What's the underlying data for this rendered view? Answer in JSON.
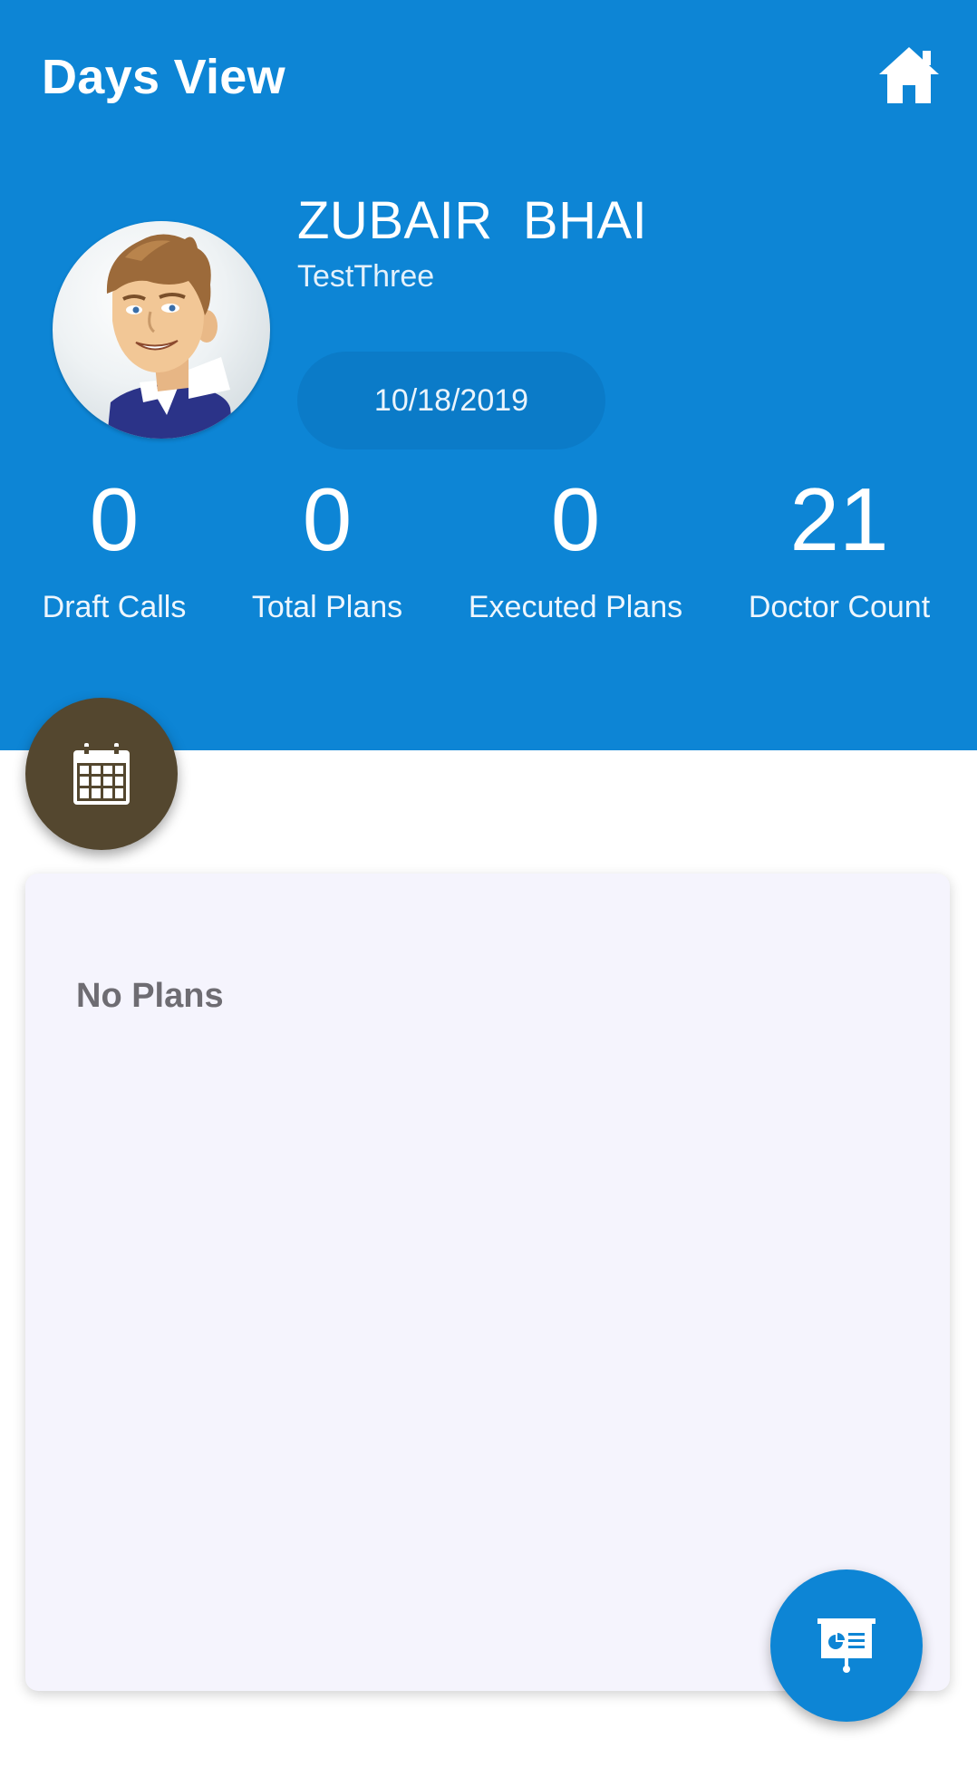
{
  "header": {
    "title": "Days View",
    "home_icon": "home-icon",
    "background_color": "#0d85d5"
  },
  "profile": {
    "name": "ZUBAIR  BHAI",
    "subtitle": "TestThree",
    "date": "10/18/2019",
    "avatar": "avatar-image"
  },
  "stats": [
    {
      "value": "0",
      "label": "Draft Calls"
    },
    {
      "value": "0",
      "label": "Total Plans"
    },
    {
      "value": "0",
      "label": "Executed Plans"
    },
    {
      "value": "21",
      "label": "Doctor Count"
    }
  ],
  "calendar_button": {
    "icon": "calendar-icon",
    "color": "#54472f"
  },
  "plans": {
    "empty_text": "No Plans"
  },
  "presentation_button": {
    "icon": "presentation-icon",
    "color": "#0d85d5"
  }
}
